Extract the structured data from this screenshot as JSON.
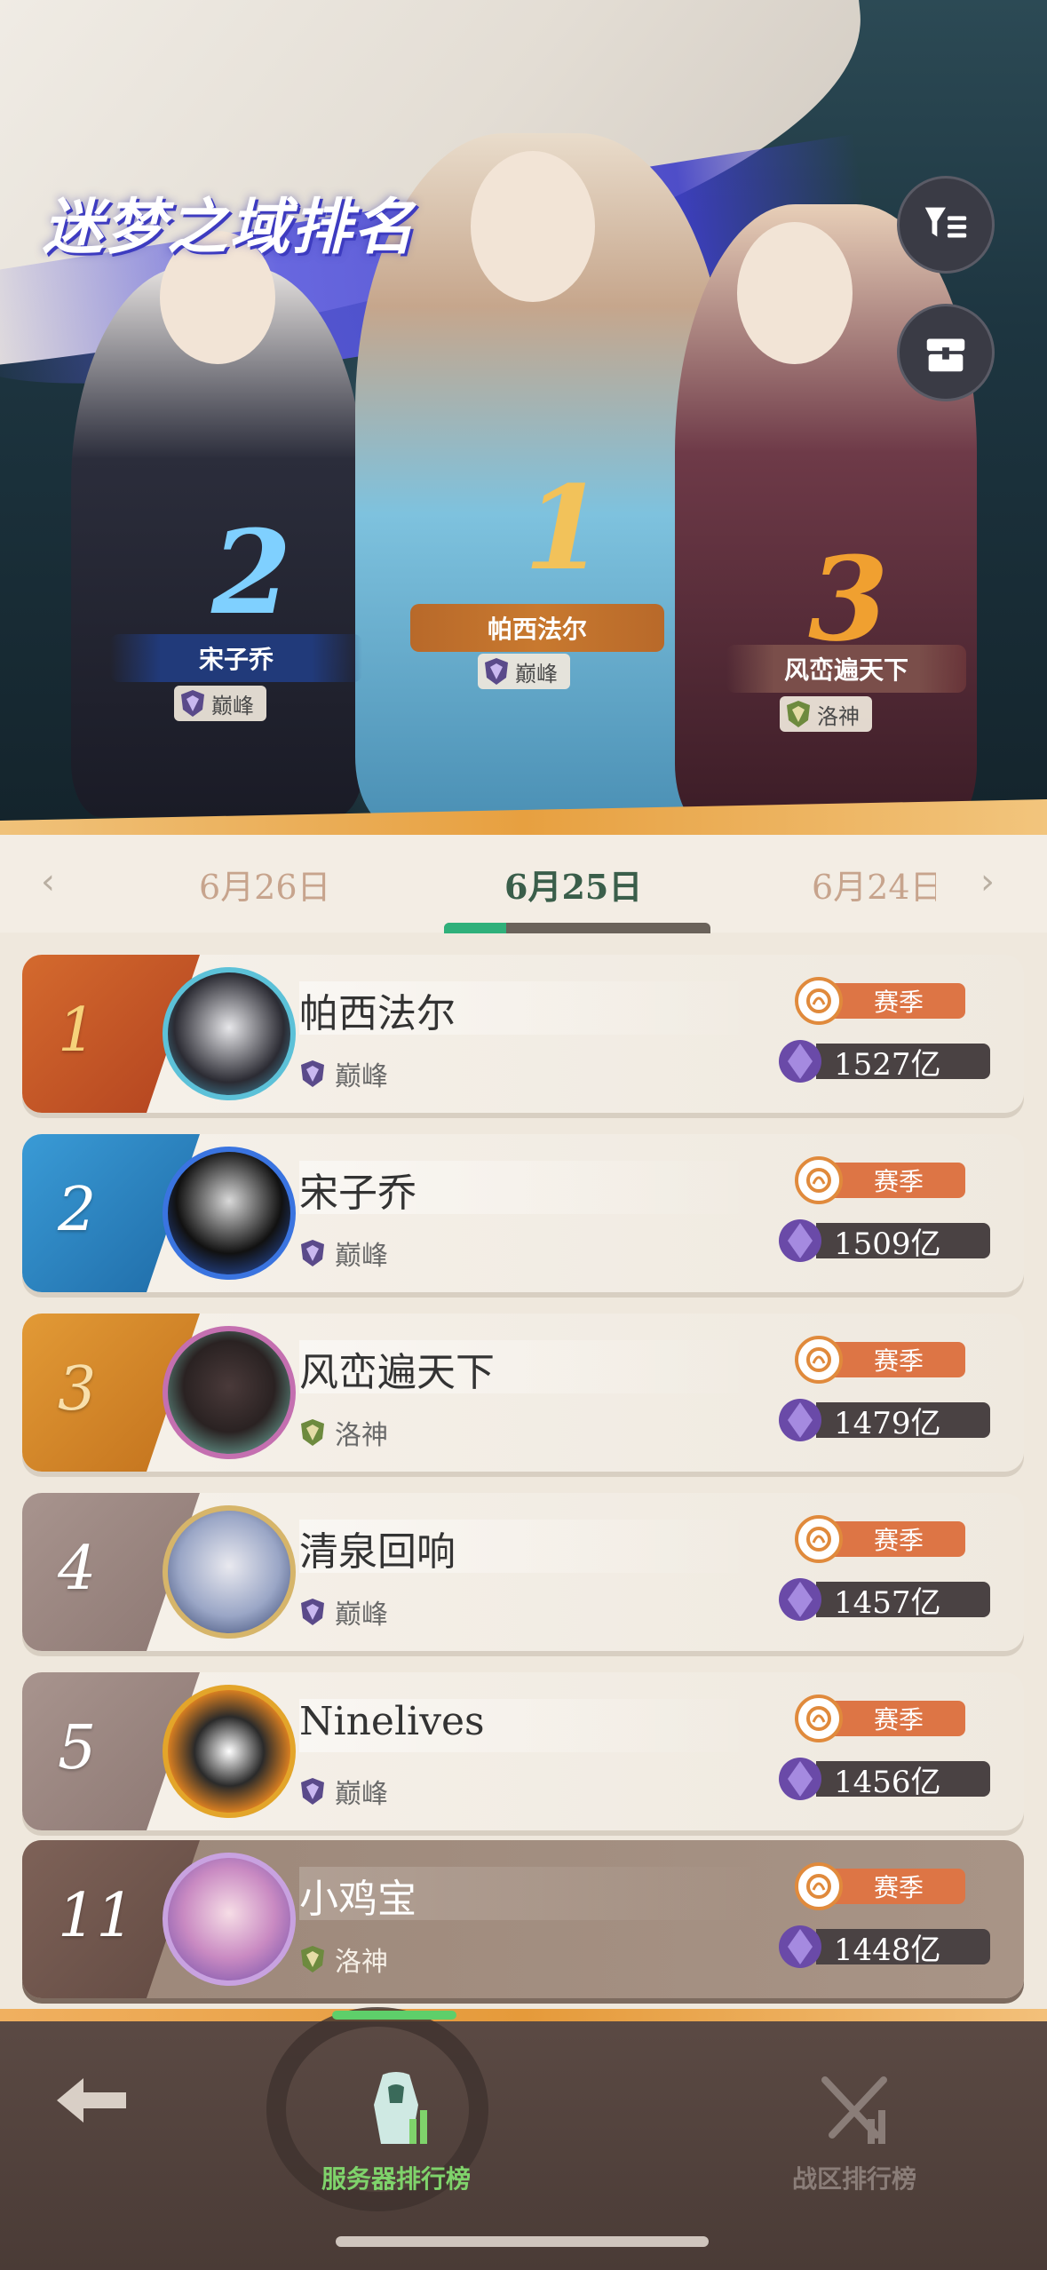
{
  "header": {
    "title": "迷梦之域排名"
  },
  "podium": [
    {
      "rank": "2",
      "name": "宋子乔",
      "tier": "巅峰",
      "color": "#2a83d6"
    },
    {
      "rank": "1",
      "name": "帕西法尔",
      "tier": "巅峰",
      "color": "#e8a53a"
    },
    {
      "rank": "3",
      "name": "风峦遍天下",
      "tier": "洛神",
      "color": "#e0862f"
    }
  ],
  "dates": {
    "prev": "6月26日",
    "current": "6月25日",
    "next": "6月24日"
  },
  "entries": [
    {
      "rank": "1",
      "name": "帕西法尔",
      "tier": "巅峰",
      "season": "赛季",
      "score": "1527亿",
      "color": "#c9542a"
    },
    {
      "rank": "2",
      "name": "宋子乔",
      "tier": "巅峰",
      "season": "赛季",
      "score": "1509亿",
      "color": "#2a86c4"
    },
    {
      "rank": "3",
      "name": "风峦遍天下",
      "tier": "洛神",
      "season": "赛季",
      "score": "1479亿",
      "color": "#d88526"
    },
    {
      "rank": "4",
      "name": "清泉回响",
      "tier": "巅峰",
      "season": "赛季",
      "score": "1457亿",
      "color": "#9b8681"
    },
    {
      "rank": "5",
      "name": "Ninelives",
      "tier": "巅峰",
      "season": "赛季",
      "score": "1456亿",
      "color": "#9b8681"
    },
    {
      "rank": "11",
      "name": "小鸡宝",
      "tier": "洛神",
      "season": "赛季",
      "score": "1448亿",
      "color": "#7a625a"
    }
  ],
  "nav": {
    "server_rank": "服务器排行榜",
    "zone_rank": "战区排行榜"
  },
  "colors": {
    "active_tab": "#7fd36b",
    "inactive_tab": "#8a7d78",
    "season_orange": "#dd7545",
    "score_bg": "#4a4243"
  }
}
